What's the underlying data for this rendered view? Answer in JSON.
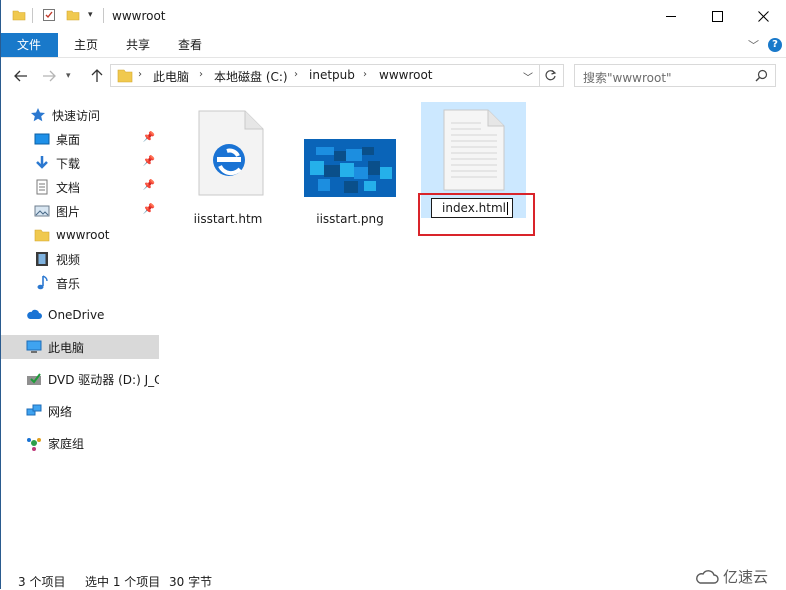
{
  "window": {
    "title": "wwwroot"
  },
  "ribbon": {
    "tabs": [
      {
        "label": "文件"
      },
      {
        "label": "主页"
      },
      {
        "label": "共享"
      },
      {
        "label": "查看"
      }
    ]
  },
  "address": {
    "segments": [
      "此电脑",
      "本地磁盘 (C:)",
      "inetpub",
      "wwwroot"
    ],
    "search_placeholder": "搜索\"wwwroot\""
  },
  "sidebar": {
    "items": [
      {
        "label": "快速访问"
      },
      {
        "label": "桌面"
      },
      {
        "label": "下载"
      },
      {
        "label": "文档"
      },
      {
        "label": "图片"
      },
      {
        "label": "wwwroot"
      },
      {
        "label": "视频"
      },
      {
        "label": "音乐"
      },
      {
        "label": "OneDrive"
      },
      {
        "label": "此电脑"
      },
      {
        "label": "DVD 驱动器 (D:) J_C"
      },
      {
        "label": "网络"
      },
      {
        "label": "家庭组"
      }
    ]
  },
  "files": [
    {
      "name": "iisstart.htm"
    },
    {
      "name": "iisstart.png"
    },
    {
      "name": "index.html"
    }
  ],
  "status": {
    "count": "3 个项目",
    "selected": "选中 1 个项目",
    "size": "30 字节"
  },
  "watermark": "亿速云",
  "colors": {
    "accent": "#1979ca",
    "selection": "#cce8ff",
    "highlight_box": "#d9242a"
  }
}
